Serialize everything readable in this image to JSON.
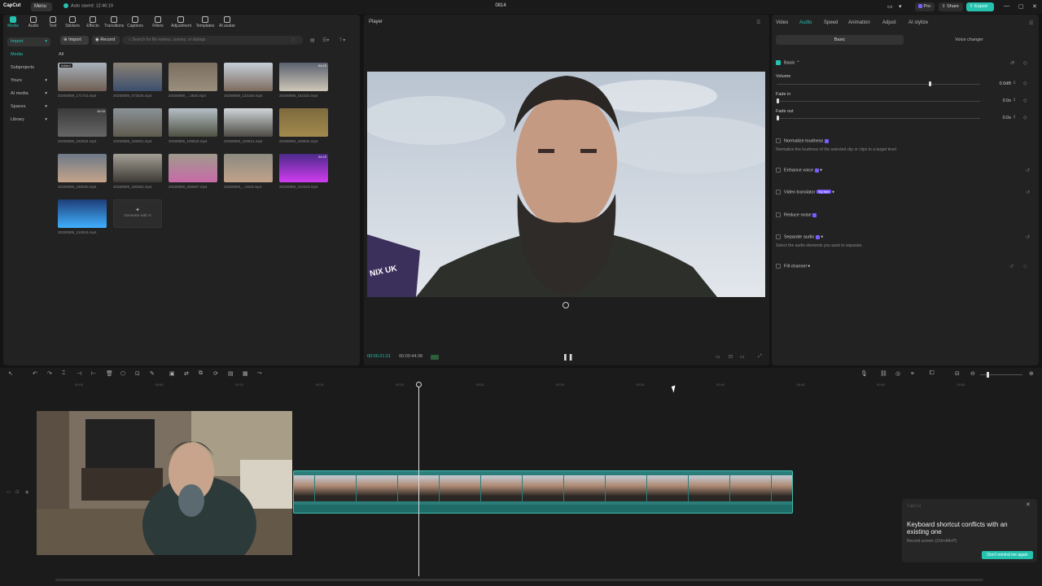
{
  "titlebar": {
    "logo": "CapCut",
    "menu": "Menu",
    "autosave": "Auto saved: 12:46:19",
    "project": "0814",
    "pro": "Pro",
    "share": "Share",
    "export": "Export"
  },
  "toolbar": [
    {
      "name": "Media",
      "active": true
    },
    {
      "name": "Audio"
    },
    {
      "name": "Text"
    },
    {
      "name": "Stickers"
    },
    {
      "name": "Effects"
    },
    {
      "name": "Transitions"
    },
    {
      "name": "Captions"
    },
    {
      "name": "Filters"
    },
    {
      "name": "Adjustment"
    },
    {
      "name": "Templates"
    },
    {
      "name": "AI avatar"
    }
  ],
  "leftnav": [
    {
      "label": "Import"
    },
    {
      "label": "Media"
    },
    {
      "label": "Subprojects"
    },
    {
      "label": "Yours"
    },
    {
      "label": "AI media"
    },
    {
      "label": "Spaces"
    },
    {
      "label": "Library"
    }
  ],
  "media": {
    "import": "Import",
    "record": "Record",
    "search_placeholder": "Search for file names, scenes, or dialogs",
    "filter_all": "All",
    "added_badge": "Added",
    "durations": {
      "d1": "10:16",
      "d2": "04:23"
    },
    "generate": "Generate with AI",
    "files": [
      "20250809_171716.mp4",
      "20250809_072525.mp4",
      "20250809_...2k30.mp4",
      "20250809_123150.mp4",
      "20250809_151022.mp4",
      "20250809_152934.mp4",
      "20250809_155001.mp4",
      "20250809_165518.mp4",
      "20250809_163631.mp4",
      "20250809_160834.mp4",
      "20250809_190530.mp4",
      "20250809_190452.mp4",
      "20250809_200507.mp4",
      "20250809_...0153.mp4",
      "20250809_210318.mp4",
      "20250809_210916.mp4"
    ]
  },
  "player": {
    "label": "Player",
    "current_time": "00:00:21:21",
    "total_time": "00:00:44:38",
    "banner_text": "NIX UK"
  },
  "inspector": {
    "tabs": [
      "Video",
      "Audio",
      "Speed",
      "Animation",
      "Adjust",
      "AI stylize"
    ],
    "active_tab": "Audio",
    "subtabs": [
      "Basic",
      "Voice changer"
    ],
    "basic": "Basic",
    "volume": "Volume",
    "volume_val": "0.0dB",
    "fadein": "Fade in",
    "fadein_val": "0.0s",
    "fadeout": "Fade out",
    "fadeout_val": "0.0s",
    "normalize": "Normalize loudness",
    "normalize_desc": "Normalize the loudness of the selected clip or clips to a target level",
    "enhance": "Enhance voice",
    "translator": "Video translator",
    "tryfree": "Try free",
    "noise": "Reduce noise",
    "separate": "Separate audio",
    "separate_desc": "Select the audio elements you want to separate.",
    "fill": "Fill channel"
  },
  "timeline": {
    "ticks": [
      "00:00",
      "00:05",
      "00:10",
      "00:15",
      "00:20",
      "00:25",
      "00:30",
      "00:35",
      "00:40",
      "00:45",
      "00:50",
      "00:55"
    ]
  },
  "toast": {
    "header": "CapCut",
    "title": "Keyboard shortcut conflicts with an existing one",
    "sub": "Record screen: [Ctrl+Alt+P]",
    "button": "Don't remind me again"
  }
}
